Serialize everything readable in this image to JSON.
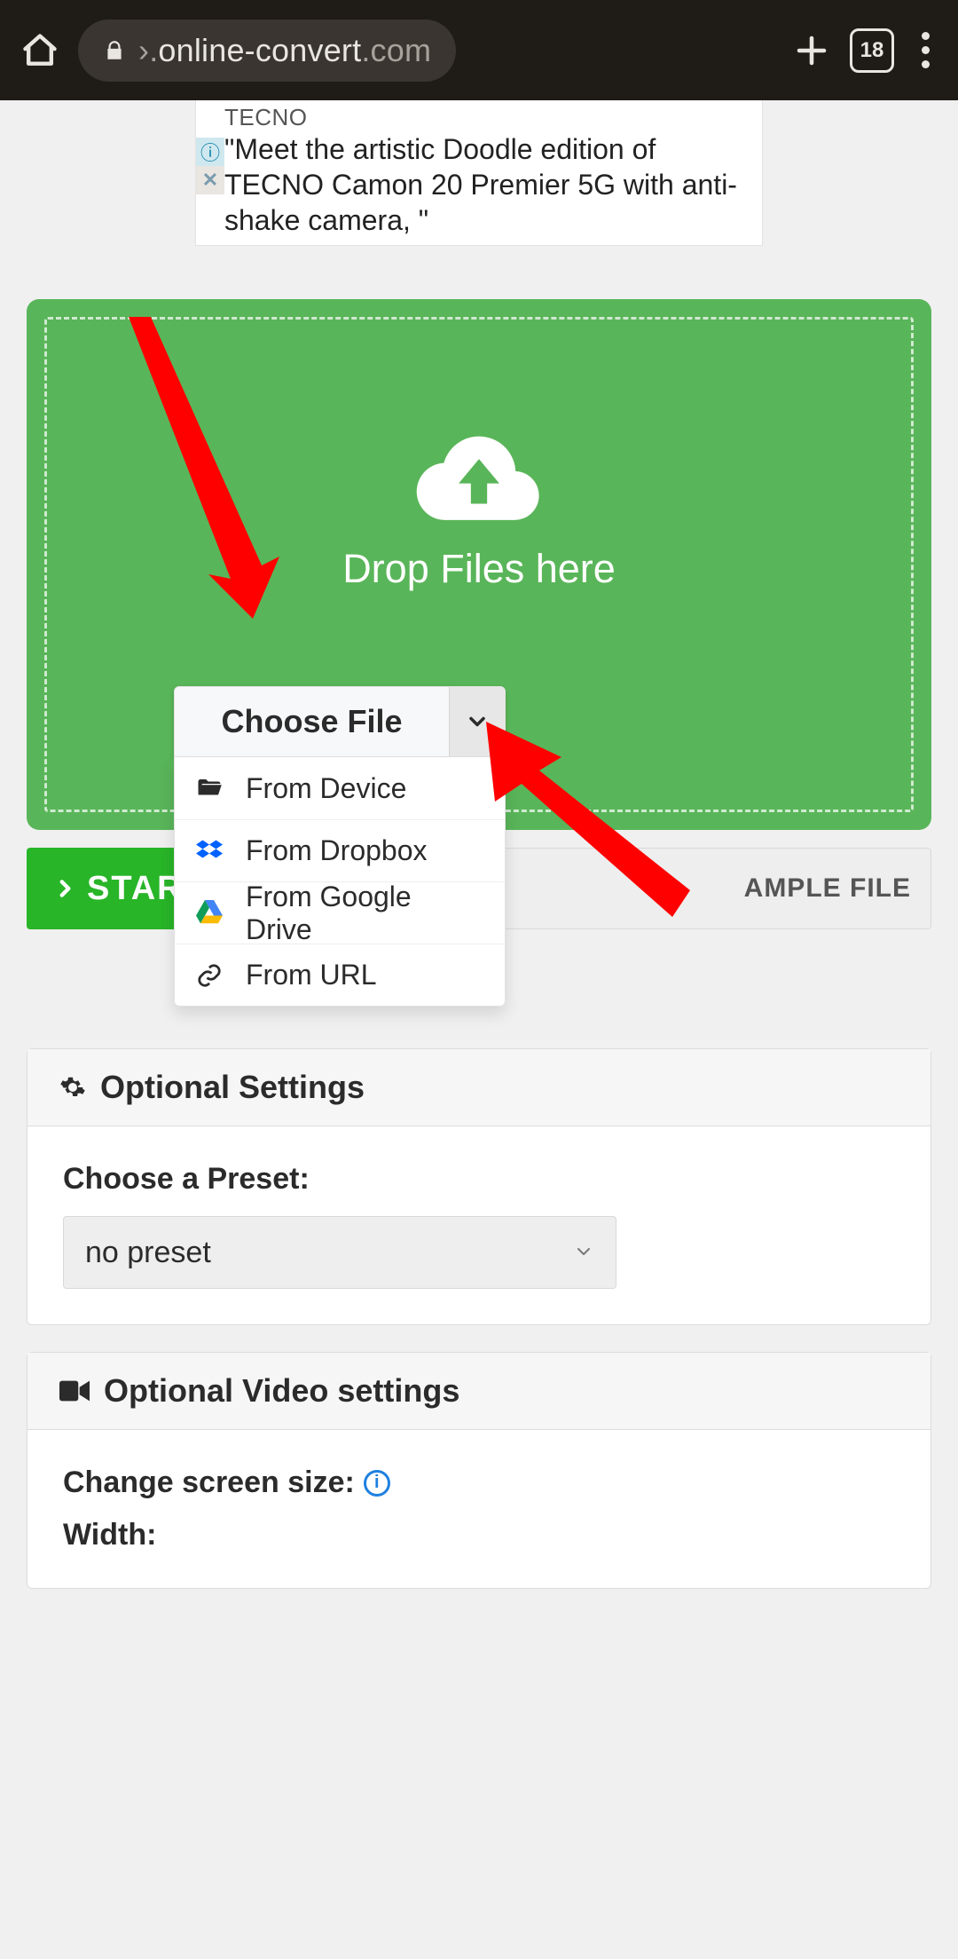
{
  "browser": {
    "url_prefix": "›.",
    "url_host": "online-convert",
    "url_suffix": ".com",
    "tab_count": "18"
  },
  "ad": {
    "brand": "TECNO",
    "copy": "\"Meet the artistic Doodle edition of TECNO Camon 20 Premier 5G with anti-shake camera, \""
  },
  "dropzone": {
    "text": "Drop Files here"
  },
  "choose": {
    "label": "Choose File",
    "menu": [
      {
        "label": "From Device",
        "icon": "folder-open-icon"
      },
      {
        "label": "From Dropbox",
        "icon": "dropbox-icon"
      },
      {
        "label": "From Google Drive",
        "icon": "google-drive-icon"
      },
      {
        "label": "From URL",
        "icon": "link-icon"
      }
    ]
  },
  "actions": {
    "start": "START",
    "example": "AMPLE FILE"
  },
  "optional": {
    "heading": "Optional Settings",
    "preset_label": "Choose a Preset:",
    "preset_value": "no preset"
  },
  "video": {
    "heading": "Optional Video settings",
    "screen_label": "Change screen size:",
    "width_label": "Width:"
  }
}
